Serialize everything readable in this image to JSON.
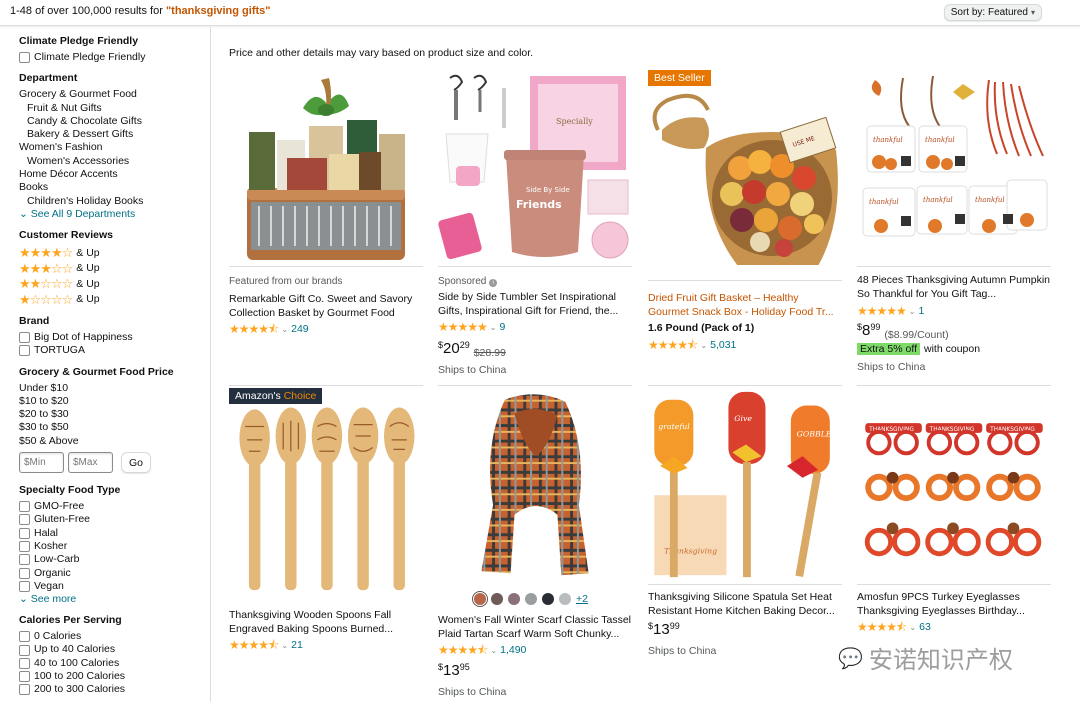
{
  "top": {
    "result_prefix": "1-48 of over 100,000 results for ",
    "query": "\"thanksgiving gifts\"",
    "sort_label": "Sort by: Featured"
  },
  "notice": "Price and other details may vary based on product size and color.",
  "sidebar": {
    "climate_heading": "Climate Pledge Friendly",
    "climate_option": "Climate Pledge Friendly",
    "dept_heading": "Department",
    "departments": [
      {
        "label": "Grocery & Gourmet Food",
        "indent": false
      },
      {
        "label": "Fruit & Nut Gifts",
        "indent": true
      },
      {
        "label": "Candy & Chocolate Gifts",
        "indent": true
      },
      {
        "label": "Bakery & Dessert Gifts",
        "indent": true
      },
      {
        "label": "Women's Fashion",
        "indent": false
      },
      {
        "label": "Women's Accessories",
        "indent": true
      },
      {
        "label": "Home Décor Accents",
        "indent": false
      },
      {
        "label": "Books",
        "indent": false
      },
      {
        "label": "Children's Holiday Books",
        "indent": true
      }
    ],
    "see_all": "See All 9 Departments",
    "reviews_heading": "Customer Reviews",
    "review_levels": [
      4,
      3,
      2,
      1
    ],
    "and_up": "& Up",
    "brand_heading": "Brand",
    "brands": [
      "Big Dot of Happiness",
      "TORTUGA"
    ],
    "price_heading": "Grocery & Gourmet Food Price",
    "price_ranges": [
      "Under $10",
      "$10 to $20",
      "$20 to $30",
      "$30 to $50",
      "$50 & Above"
    ],
    "min_placeholder": "$Min",
    "max_placeholder": "$Max",
    "go_label": "Go",
    "specialty_heading": "Specialty Food Type",
    "specialty": [
      "GMO-Free",
      "Gluten-Free",
      "Halal",
      "Kosher",
      "Low-Carb",
      "Organic",
      "Vegan"
    ],
    "see_more": "See more",
    "calories_heading": "Calories Per Serving",
    "calories": [
      "0 Calories",
      "Up to 40 Calories",
      "40 to 100 Calories",
      "100 to 200 Calories",
      "200 to 300 Calories"
    ]
  },
  "products": [
    {
      "meta": "Featured from our brands",
      "title": "Remarkable Gift Co. Sweet and Savory Collection Basket by Gourmet Food",
      "rating": 4.5,
      "reviews": "249"
    },
    {
      "meta": "Sponsored",
      "title": "Side by Side Tumbler Set Inspirational Gifts, Inspirational Gift for Friend, the...",
      "rating": 5,
      "reviews": "9",
      "price_whole": "20",
      "price_frac": "29",
      "list_price": "$28.99",
      "ships": "Ships to China"
    },
    {
      "badge": "Best Seller",
      "title": "Dried Fruit Gift Basket – Healthy Gourmet Snack Box - Holiday Food Tr...",
      "variant": "1.6 Pound (Pack of 1)",
      "rating": 4.5,
      "reviews": "5,031"
    },
    {
      "title": "48 Pieces Thanksgiving Autumn Pumpkin So Thankful for You Gift Tag...",
      "rating": 5,
      "reviews": "1",
      "price_whole": "8",
      "price_frac": "99",
      "unit_price": "($8.99/Count)",
      "coupon_tag": "Extra 5% off",
      "coupon_text": "with coupon",
      "ships": "Ships to China"
    },
    {
      "badge_a": "Amazon's",
      "badge_b": "Choice",
      "title": "Thanksgiving Wooden Spoons Fall Engraved Baking Spoons Burned...",
      "rating": 4.5,
      "reviews": "21"
    },
    {
      "swatch_more": "+2",
      "title": "Women's Fall Winter Scarf Classic Tassel Plaid Tartan Scarf Warm Soft Chunky...",
      "rating": 4.5,
      "reviews": "1,490",
      "price_whole": "13",
      "price_frac": "95",
      "ships": "Ships to China"
    },
    {
      "title": "Thanksgiving Silicone Spatula Set Heat Resistant Home Kitchen Baking Decor...",
      "price_whole": "13",
      "price_frac": "99",
      "ships": "Ships to China"
    },
    {
      "title": "Amosfun 9PCS Turkey Eyeglasses Thanksgiving Eyeglasses Birthday...",
      "rating": 4.5,
      "reviews": "63"
    }
  ],
  "watermark": "安诺知识产权",
  "colors": {
    "link": "#007185",
    "star": "#ffa41c",
    "best_seller": "#e77600",
    "choice": "#232f3e",
    "query": "#c45500",
    "coupon": "#7fda69"
  }
}
